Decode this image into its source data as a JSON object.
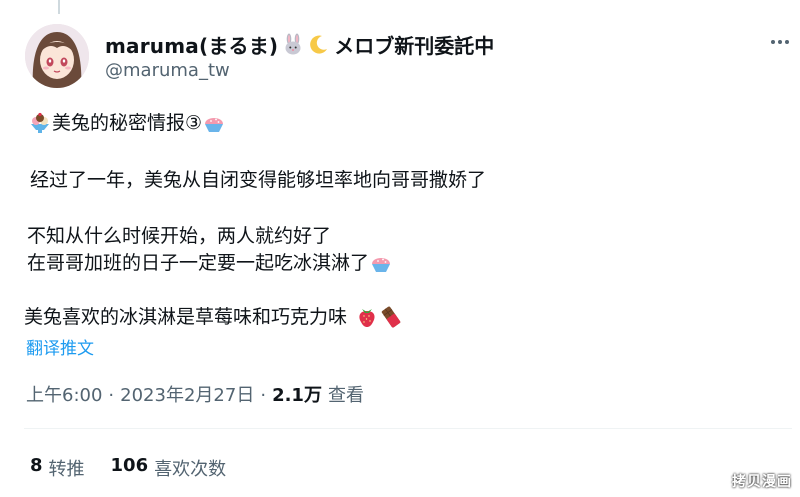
{
  "author": {
    "display_name": "maruma(まるま)",
    "name_suffix": "メロブ新刊委託中",
    "name_emojis": [
      "rabbit-face",
      "crescent-moon"
    ],
    "handle": "@maruma_tw"
  },
  "post": {
    "lines": [
      {
        "text": "美兔的秘密情报③",
        "lead_emoji": "ice-cream-sundae",
        "trail_emoji": "shaved-ice"
      },
      {
        "text": "经过了一年，美兔从自闭变得能够坦率地向哥哥撒娇了"
      },
      {
        "text": "不知从什么时候开始，两人就约好了"
      },
      {
        "text": "在哥哥加班的日子一定要一起吃冰淇淋了",
        "trail_emoji": "shaved-ice"
      },
      {
        "text": "美兔喜欢的冰淇淋是草莓味和巧克力味",
        "trail_emojis": [
          "strawberry",
          "chocolate-bar"
        ]
      }
    ],
    "translate_label": "翻译推文"
  },
  "meta": {
    "time": "上午6:00",
    "sep1": "·",
    "date": "2023年2月27日",
    "sep2": "·",
    "views_count": "2.1万",
    "views_label": "查看"
  },
  "stats": {
    "retweets_count": "8",
    "retweets_label": "转推",
    "likes_count": "106",
    "likes_label": "喜欢次数"
  },
  "watermark": "拷贝漫画",
  "colors": {
    "text": "#0f1419",
    "secondary": "#536471",
    "link": "#1d9bf0",
    "divider": "#eff3f4"
  }
}
